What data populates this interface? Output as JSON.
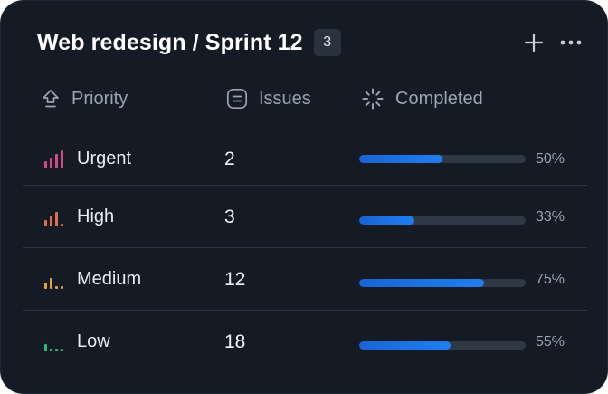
{
  "header": {
    "title": "Web redesign / Sprint 12",
    "count": "3",
    "add_icon": "plus-icon",
    "more_icon": "more-horizontal-icon"
  },
  "columns": {
    "priority": {
      "label": "Priority",
      "icon": "priority-arrow-icon"
    },
    "issues": {
      "label": "Issues",
      "icon": "issues-equals-icon"
    },
    "completed": {
      "label": "Completed",
      "icon": "loading-spinner-icon"
    }
  },
  "rows": [
    {
      "priority": "Urgent",
      "issues": "2",
      "completed": "50%",
      "progress": 0.5,
      "color": "#d04a86",
      "level": 4
    },
    {
      "priority": "High",
      "issues": "3",
      "completed": "33%",
      "progress": 0.33,
      "color": "#e0704d",
      "level": 3
    },
    {
      "priority": "Medium",
      "issues": "12",
      "completed": "75%",
      "progress": 0.75,
      "color": "#e0a23a",
      "level": 2
    },
    {
      "priority": "Low",
      "issues": "18",
      "completed": "55%",
      "progress": 0.55,
      "color": "#2fb87a",
      "level": 1
    }
  ],
  "colors": {
    "card_bg": "#141b25",
    "progress_fill": "#1f7ff0",
    "progress_track": "#2f3844"
  }
}
